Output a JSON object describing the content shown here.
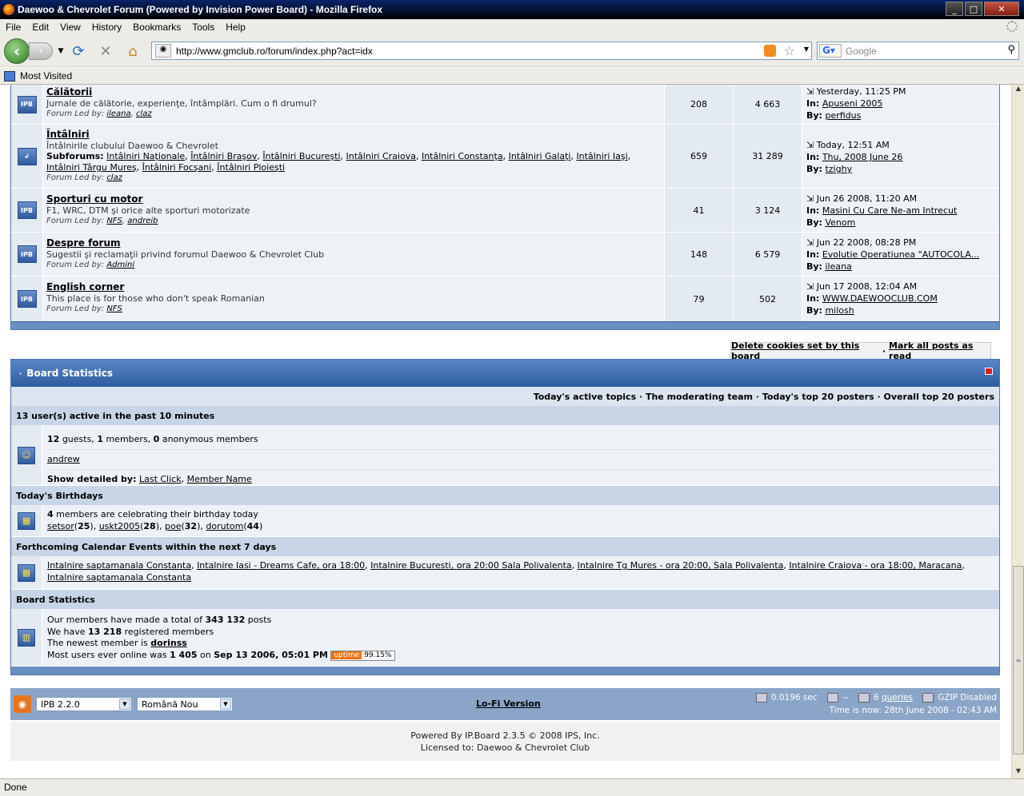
{
  "window": {
    "title": "Daewoo & Chevrolet Forum (Powered by Invision Power Board) - Mozilla Firefox"
  },
  "menu": [
    "File",
    "Edit",
    "View",
    "History",
    "Bookmarks",
    "Tools",
    "Help"
  ],
  "nav": {
    "url": "http://www.gmclub.ro/forum/index.php?act=idx",
    "search_placeholder": "Google"
  },
  "bookmarks": {
    "most_visited": "Most Visited"
  },
  "forums": [
    {
      "name": "Călătorii",
      "desc": "Jurnale de călătorie, experienţe, întâmplări. Cum o fi drumul?",
      "led_label": "Forum Led by:",
      "leaders": [
        "ileana",
        "claz"
      ],
      "topics": "208",
      "posts": "4 663",
      "last_date": "Yesterday, 11:25 PM",
      "last_in": "Apuseni 2005",
      "last_by": "perfidus"
    },
    {
      "name": "Întâlniri",
      "desc": "Întâlnirile clubului Daewoo & Chevrolet",
      "subforums_label": "Subforums:",
      "subforums": [
        "Intâlniri Naţionale",
        "Întâlniri Braşov",
        "Întâlniri Bucureşti",
        "Intâlniri Craiova",
        "Intâlniri Constanţa",
        "Intâlniri Galaţi",
        "Intâlniri Iaşi",
        "Intâlniri Târgu Mureş",
        "Întâlniri Focşani",
        "Întâlniri Ploieşti"
      ],
      "led_label": "Forum Led by:",
      "leaders": [
        "claz"
      ],
      "topics": "659",
      "posts": "31 289",
      "last_date": "Today, 12:51 AM",
      "last_in": "Thu, 2008 June 26",
      "last_by": "tzighy"
    },
    {
      "name": "Sporturi cu motor",
      "desc": "F1, WRC, DTM şi orice alte sporturi motorizate",
      "led_label": "Forum Led by:",
      "leaders": [
        "NFS",
        "andreib"
      ],
      "topics": "41",
      "posts": "3 124",
      "last_date": "Jun 26 2008, 11:20 AM",
      "last_in": "Masini Cu Care Ne-am Intrecut",
      "last_by": "Venom"
    },
    {
      "name": "Despre forum",
      "desc": "Sugestii şi reclamaţii privind forumul Daewoo & Chevrolet Club",
      "led_label": "Forum Led by:",
      "leaders": [
        "Admini"
      ],
      "topics": "148",
      "posts": "6 579",
      "last_date": "Jun 22 2008, 08:28 PM",
      "last_in": "Evolutie Operatiunea \"AUTOCOLA...",
      "last_by": "ileana"
    },
    {
      "name": "English corner",
      "desc": "This place is for those who don't speak Romanian",
      "led_label": "Forum Led by:",
      "leaders": [
        "NFS"
      ],
      "topics": "79",
      "posts": "502",
      "last_date": "Jun 17 2008, 12:04 AM",
      "last_in": "WWW.DAEWOOCLUB.COM",
      "last_by": "milosh"
    }
  ],
  "labels": {
    "in": "In:",
    "by": "By:"
  },
  "board_links": {
    "delete_cookies": "Delete cookies set by this board",
    "sep": "·",
    "mark_read": "Mark all posts as read"
  },
  "stats": {
    "title": "Board Statistics",
    "top_links": [
      "Today's active topics",
      "The moderating team",
      "Today's top 20 posters",
      "Overall top 20 posters"
    ],
    "active": {
      "heading": "13 user(s) active in the past 10 minutes",
      "guests": "12",
      "guests_label": "guests,",
      "members": "1",
      "members_label": "members,",
      "anon": "0",
      "anon_label": "anonymous members",
      "user": "andrew",
      "detail_label": "Show detailed by:",
      "detail_links": [
        "Last Click",
        "Member Name"
      ]
    },
    "birthdays": {
      "heading": "Today's Birthdays",
      "count": "4",
      "text": "members are celebrating their birthday today",
      "people": [
        {
          "name": "setsor",
          "age": "25"
        },
        {
          "name": "uskt2005",
          "age": "28"
        },
        {
          "name": "poe",
          "age": "32"
        },
        {
          "name": "dorutom",
          "age": "44"
        }
      ]
    },
    "calendar": {
      "heading": "Forthcoming Calendar Events within the next 7 days",
      "events": [
        "Intalnire saptamanala Constanta",
        "Intalnire Iasi - Dreams Cafe, ora 18:00",
        "Intalnire Bucuresti, ora 20:00 Sala Polivalenta",
        "Intalnire Tg Mures - ora 20:00, Sala Polivalenta",
        "Intalnire Craiova - ora 18:00, Maracana",
        "Intalnire saptamanala Constanta"
      ]
    },
    "board": {
      "heading": "Board Statistics",
      "posts_pre": "Our members have made a total of",
      "posts": "343 132",
      "posts_post": "posts",
      "reg_pre": "We have",
      "registered": "13 218",
      "reg_post": "registered members",
      "newest_pre": "The newest member is",
      "newest": "dorinss",
      "online_pre": "Most users ever online was",
      "online": "1 405",
      "online_mid": "on",
      "online_date": "Sep 13 2006, 05:01 PM",
      "uptime_label": "uptime",
      "uptime": "99.15%"
    }
  },
  "footer": {
    "skin": "IPB 2.2.0",
    "lang": "Română Nou",
    "lofi": "Lo-Fi Version",
    "time_exec": "0.0196 sec",
    "load": "--",
    "queries_count": "6",
    "queries": "queries",
    "gzip": "GZIP Disabled",
    "now": "Time is now: 28th June 2008 - 02:43 AM",
    "powered": "Powered By IP.Board 2.3.5 © 2008  IPS, Inc.",
    "licensed": "Licensed to: Daewoo & Chevrolet Club"
  },
  "status": "Done"
}
